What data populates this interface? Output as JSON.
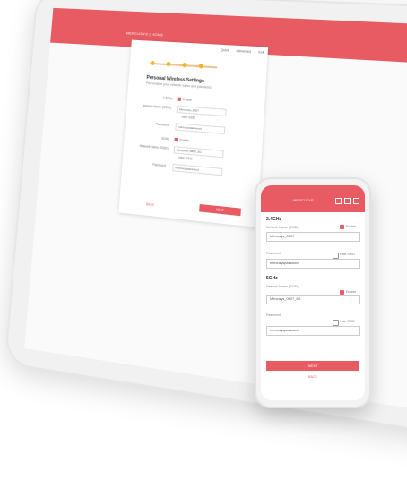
{
  "tablet": {
    "brand": "MERCUSYS | HOME",
    "nav": [
      "Quick",
      "Advanced",
      "Exit"
    ],
    "card": {
      "title": "Personal Wireless Settings",
      "subtitle": "Personalize your network name and password.",
      "band_2g": {
        "label": "2.4GHz",
        "enable": "Enable",
        "ssid_label": "Network Name (SSID):",
        "ssid": "Mercusys_0B07",
        "hide": "Hide SSID",
        "password_label": "Password:",
        "password": "mercusyspassword"
      },
      "band_5g": {
        "label": "5GHz",
        "enable": "Enable",
        "ssid_label": "Network Name (SSID):",
        "ssid": "Mercusys_0B07_5G",
        "hide": "Hide SSID",
        "password_label": "Password:",
        "password": "mercusyspassword"
      },
      "back": "BACK",
      "next": "NEXT"
    }
  },
  "phone": {
    "title": "MERCUSYS",
    "band_2g": {
      "section": "2.4GHz",
      "enable": "Enable",
      "ssid_label": "Network Name (SSID)",
      "ssid": "Mercusys_0B07",
      "password_label": "Password",
      "hide": "Hide SSID",
      "password": "mercusyspassword"
    },
    "band_5g": {
      "section": "5GHz",
      "enable": "Enable",
      "ssid_label": "Network Name (SSID)",
      "ssid": "Mercusys_0B07_5G",
      "password_label": "Password",
      "hide": "Hide SSID",
      "password": "mercusyspassword"
    },
    "next": "NEXT",
    "back": "BACK"
  },
  "colors": {
    "accent": "#e85b62",
    "step": "#f3b42b"
  }
}
